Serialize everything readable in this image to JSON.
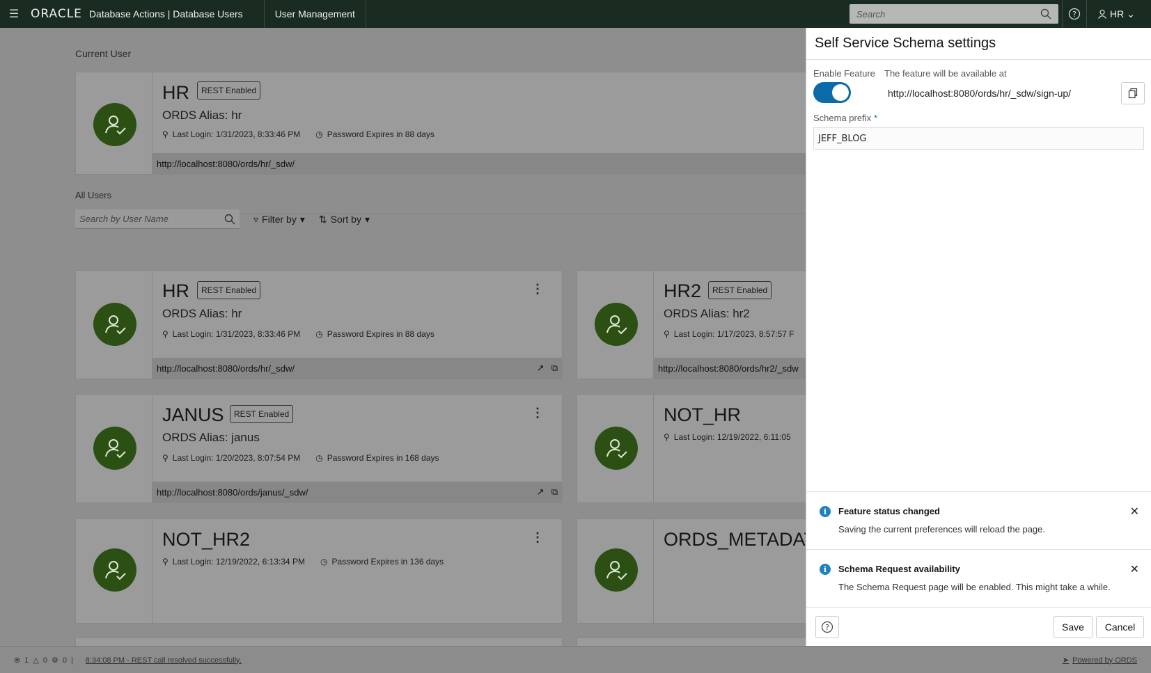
{
  "topbar": {
    "brand": "ORACLE",
    "app_title": "Database Actions | Database Users",
    "nav_item": "User Management",
    "search_placeholder": "Search",
    "user": "HR"
  },
  "current_user_section": "Current User",
  "all_users_section": "All Users",
  "current_user": {
    "name": "HR",
    "badge": "REST Enabled",
    "alias": "ORDS Alias: hr",
    "last_login": "Last Login: 1/31/2023, 8:33:46 PM",
    "password": "Password Expires in 88 days",
    "url": "http://localhost:8080/ords/hr/_sdw/"
  },
  "filters": {
    "search_placeholder": "Search by User Name",
    "filter_label": "Filter by",
    "sort_label": "Sort by"
  },
  "cards": [
    {
      "name": "HR",
      "badge": "REST Enabled",
      "alias": "ORDS Alias: hr",
      "last_login": "Last Login: 1/31/2023, 8:33:46 PM",
      "password": "Password Expires in 88 days",
      "url": "http://localhost:8080/ords/hr/_sdw/"
    },
    {
      "name": "HR2",
      "badge": "REST Enabled",
      "alias": "ORDS Alias: hr2",
      "last_login": "Last Login: 1/17/2023, 8:57:57 F",
      "url": "http://localhost:8080/ords/hr2/_sdw"
    },
    {
      "name": "JANUS",
      "badge": "REST Enabled",
      "alias": "ORDS Alias: janus",
      "last_login": "Last Login: 1/20/2023, 8:07:54 PM",
      "password": "Password Expires in 168 days",
      "url": "http://localhost:8080/ords/janus/_sdw/"
    },
    {
      "name": "NOT_HR",
      "last_login": "Last Login: 12/19/2022, 6:11:05"
    },
    {
      "name": "NOT_HR2",
      "last_login": "Last Login: 12/19/2022, 6:13:34 PM",
      "password": "Password Expires in 136 days"
    },
    {
      "name": "ORDS_METADAT"
    }
  ],
  "panel": {
    "title": "Self Service Schema settings",
    "enable_label": "Enable Feature",
    "enabled": true,
    "avail_label": "The feature will be available at",
    "avail_url": "http://localhost:8080/ords/hr/_sdw/sign-up/",
    "prefix_label": "Schema prefix",
    "prefix_required": "*",
    "prefix_value": "JEFF_BLOG",
    "notices": [
      {
        "title": "Feature status changed",
        "body": "Saving the current preferences will reload the page."
      },
      {
        "title": "Schema Request availability",
        "body": "The Schema Request page will be enabled. This might take a while."
      }
    ],
    "save": "Save",
    "cancel": "Cancel"
  },
  "statusbar": {
    "errors": "1",
    "warnings": "0",
    "tasks": "0",
    "message": "8:34:08 PM - REST call resolved successfully.",
    "powered": "Powered by ORDS"
  }
}
